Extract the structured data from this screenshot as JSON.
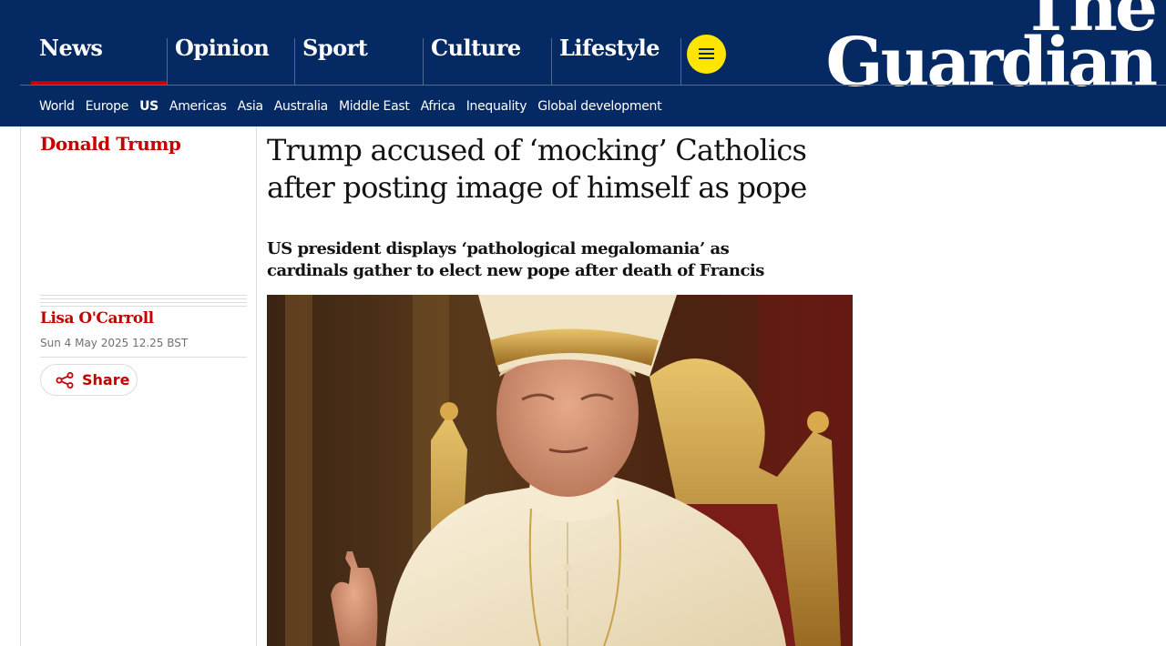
{
  "masthead": {
    "pillars": [
      "News",
      "Opinion",
      "Sport",
      "Culture",
      "Lifestyle"
    ],
    "menu_icon": "hamburger-menu-icon",
    "logo_line1": "The",
    "logo_line2": "Guardian"
  },
  "subnav": {
    "items": [
      "World",
      "Europe",
      "US",
      "Americas",
      "Asia",
      "Australia",
      "Middle East",
      "Africa",
      "Inequality",
      "Global development"
    ],
    "active": "US"
  },
  "article": {
    "section": "Donald Trump",
    "headline": "Trump accused of ‘mocking’ Catholics after posting image of himself as pope",
    "standfirst": "US president displays ‘pathological megalomania’ as cardinals gather to elect new pope after death of Francis",
    "author": "Lisa O'Carroll",
    "date": "Sun 4 May 2025 12.25 BST",
    "share_label": "Share",
    "share_icon": "share-icon"
  },
  "colors": {
    "brand_blue": "#052962",
    "news_red": "#c70000",
    "menu_yellow": "#ffe500"
  }
}
